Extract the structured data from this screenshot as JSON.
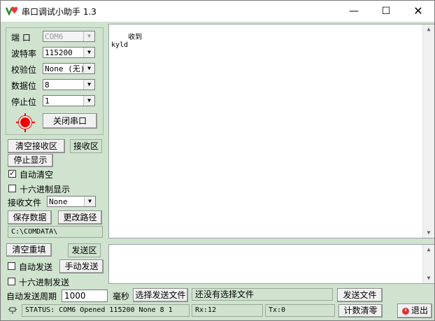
{
  "window": {
    "title": "串口调试小助手 1.3",
    "min_glyph": "—",
    "max_glyph": "☐",
    "close_glyph": "✕"
  },
  "serial": {
    "port_label": "端  口",
    "port_value": "COM6",
    "baud_label": "波特率",
    "baud_value": "115200",
    "parity_label": "校验位",
    "parity_value": "None (无)",
    "databits_label": "数据位",
    "databits_value": "8",
    "stopbits_label": "停止位",
    "stopbits_value": "1",
    "close_port_button": "关闭串口",
    "status_color": "#e00000"
  },
  "receive": {
    "clear_button": "清空接收区",
    "area_tag": "接收区",
    "stop_display_button": "停止显示",
    "auto_clear_label": "自动清空",
    "auto_clear_checked": true,
    "hex_display_label": "十六进制显示",
    "hex_display_checked": false,
    "file_label": "接收文件",
    "file_format": "None",
    "save_button": "保存数据",
    "change_path_button": "更改路径",
    "path": "C:\\COMDATA\\",
    "content": "收到\nkyld"
  },
  "send": {
    "clear_button": "清空重填",
    "area_tag": "发送区",
    "auto_send_label": "自动发送",
    "auto_send_checked": false,
    "manual_send_button": "手动发送",
    "hex_send_label": "十六进制发送",
    "hex_send_checked": false,
    "period_label": "自动发送周期",
    "period_value": "1000",
    "period_unit": "毫秒",
    "choose_file_button": "选择发送文件",
    "file_status": "还没有选择文件",
    "send_file_button": "发送文件",
    "content": ""
  },
  "statusbar": {
    "status": "STATUS: COM6 Opened 115200 None  8 1",
    "rx": "Rx:12",
    "tx": "Tx:0",
    "reset_count_button": "计数清零",
    "exit_button": "退出",
    "check_glyph": "✓",
    "combo_arrow": "▼",
    "scroll_up": "▲",
    "scroll_down": "▼"
  }
}
